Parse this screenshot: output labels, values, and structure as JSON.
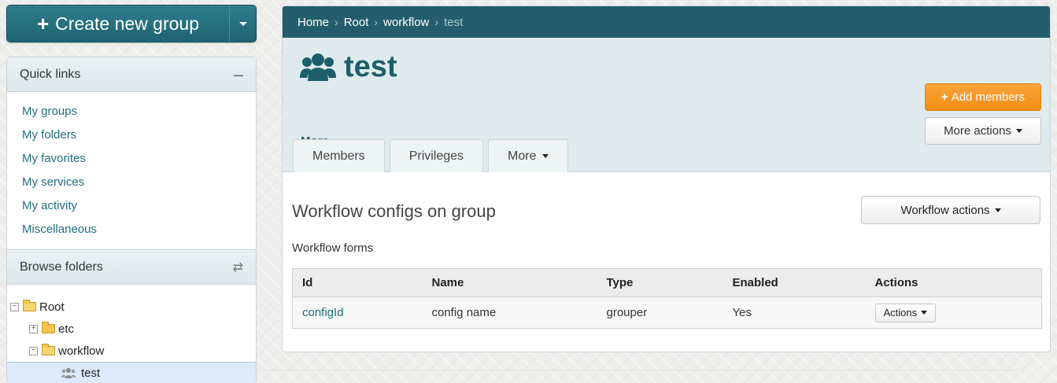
{
  "sidebar": {
    "create_button_label": "Create new group",
    "quick_links": {
      "title": "Quick links",
      "items": [
        "My groups",
        "My folders",
        "My favorites",
        "My services",
        "My activity",
        "Miscellaneous"
      ]
    },
    "browse": {
      "title": "Browse folders",
      "tree": [
        {
          "label": "Root",
          "expanded": true
        },
        {
          "label": "etc",
          "expanded": false
        },
        {
          "label": "workflow",
          "expanded": true
        },
        {
          "label": "test",
          "selected": true
        }
      ]
    }
  },
  "breadcrumb": {
    "items": [
      "Home",
      "Root",
      "workflow"
    ],
    "current": "test"
  },
  "header": {
    "title": "test",
    "more_label": "More",
    "add_members_label": "Add members",
    "more_actions_label": "More actions"
  },
  "tabs": [
    "Members",
    "Privileges",
    "More"
  ],
  "section": {
    "title": "Workflow configs on group",
    "workflow_actions_label": "Workflow actions",
    "forms_label": "Workflow forms"
  },
  "table": {
    "columns": [
      "Id",
      "Name",
      "Type",
      "Enabled",
      "Actions"
    ],
    "rows": [
      {
        "id": "configId",
        "name": "config name",
        "type": "grouper",
        "enabled": "Yes",
        "actions": "Actions"
      }
    ]
  },
  "colors": {
    "brand_dark": "#245e6c",
    "accent_orange": "#f39a2a",
    "link": "#1f6e7e"
  },
  "icons": [
    "plus-icon",
    "caret-down-icon",
    "minus-icon",
    "swap-icon",
    "folder-icon",
    "group-icon"
  ]
}
